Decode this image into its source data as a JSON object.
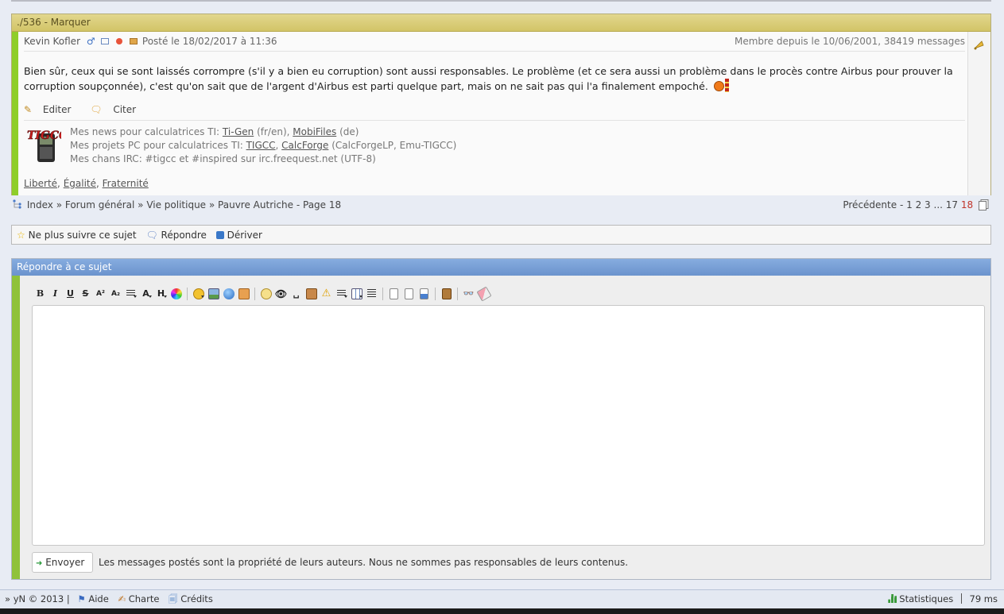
{
  "post": {
    "header": "./536 - Marquer",
    "author": "Kevin Kofler",
    "posted": "Posté le 18/02/2017 à 11:36",
    "member_info": "Membre depuis le 10/06/2001, 38419 messages",
    "content": "Bien sûr, ceux qui se sont laissés corrompre (s'il y a bien eu corruption) sont aussi responsables. Le problème (et ce sera aussi un problème dans le procès contre Airbus pour prouver la corruption soupçonnée), c'est qu'on sait que de l'argent d'Airbus est parti quelque part, mais on ne sait pas qui l'a finalement empoché.",
    "actions": {
      "edit": "Editer",
      "quote": "Citer"
    },
    "signature": {
      "logo_text": "TIGCC",
      "line1_prefix": "Mes news pour calculatrices TI: ",
      "line1_link1": "Ti-Gen",
      "line1_mid": " (fr/en), ",
      "line1_link2": "MobiFiles",
      "line1_suffix": " (de)",
      "line2_prefix": "Mes projets PC pour calculatrices TI: ",
      "line2_link1": "TIGCC",
      "line2_mid": ", ",
      "line2_link2": "CalcForge",
      "line2_suffix": " (CalcForgeLP, Emu-TIGCC)",
      "line3": "Mes chans IRC: #tigcc et #inspired sur irc.freequest.net (UTF-8)",
      "motto1": "Liberté",
      "motto2": "Égalité",
      "motto3": "Fraternité"
    }
  },
  "breadcrumb": {
    "index": "Index",
    "sep": " » ",
    "forum": "Forum général",
    "section": "Vie politique",
    "topic": "Pauvre Autriche - Page 18"
  },
  "pager": {
    "prev": "Précédente",
    "dash": " - ",
    "p1": "1",
    "p2": "2",
    "p3": "3",
    "ellipsis": "...",
    "p17": "17",
    "current": "18"
  },
  "followbar": {
    "unfollow": "Ne plus suivre ce sujet",
    "reply": "Répondre",
    "derive": "Dériver"
  },
  "reply": {
    "title": "Répondre à ce sujet",
    "toolbar": {
      "bold": "B",
      "italic": "I",
      "underline": "U",
      "strike": "S",
      "sup": "A²",
      "sub": "A₂",
      "size": "A",
      "heading": "H"
    },
    "editor_value": "",
    "send": "Envoyer",
    "disclaimer": "Les messages postés sont la propriété de leurs auteurs. Nous ne sommes pas responsables de leurs contenus."
  },
  "footer": {
    "copyright": "» yN © 2013 |",
    "help": "Aide",
    "charter": "Charte",
    "credits": "Crédits",
    "stats": "Statistiques",
    "timing": "79 ms"
  },
  "colors": {
    "post_header": "#d9cc78",
    "post_accent": "#8fce2a",
    "reply_header": "#7aa0d6",
    "reply_accent": "#8fc23a",
    "current_page": "#c0342a"
  }
}
